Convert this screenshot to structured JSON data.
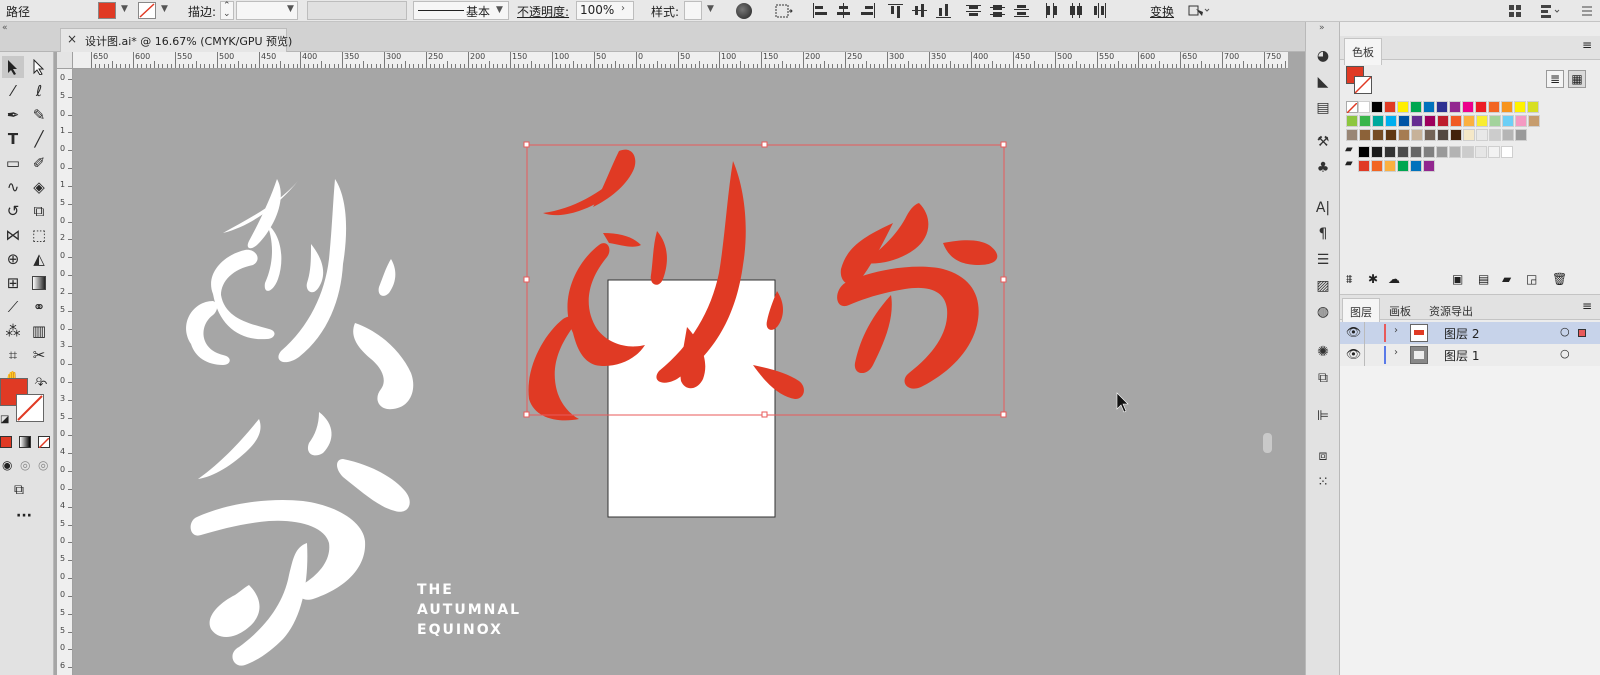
{
  "control_bar": {
    "object_type": "路径",
    "stroke_label": "描边:",
    "stroke_profile": "基本",
    "opacity_label": "不透明度:",
    "opacity_value": "100%",
    "style_label": "样式:",
    "transform_label": "变换",
    "fill_color": "#e03a24"
  },
  "document_tab": {
    "title": "设计图.ai* @ 16.67% (CMYK/GPU 预览)",
    "close": "×"
  },
  "ruler": {
    "h_labels": [
      "650",
      "600",
      "550",
      "500",
      "450",
      "400",
      "350",
      "300",
      "250",
      "200",
      "150",
      "100",
      "50",
      "0",
      "50",
      "100",
      "150",
      "200",
      "250",
      "300",
      "350",
      "400",
      "450",
      "500",
      "550",
      "600",
      "650",
      "700",
      "750"
    ],
    "v_labels": [
      "0",
      "5",
      "0",
      "1",
      "0",
      "0",
      "1",
      "5",
      "0",
      "2",
      "0",
      "0",
      "2",
      "5",
      "0",
      "3",
      "0",
      "0",
      "3",
      "5",
      "0",
      "4",
      "0",
      "0",
      "4",
      "5",
      "0",
      "5",
      "0",
      "0",
      "5",
      "5",
      "0",
      "6"
    ]
  },
  "artwork": {
    "subtitle_lines": [
      "THE",
      "AUTUMNAL",
      "EQUINOX"
    ],
    "red_color": "#e03a24",
    "white_color": "#ffffff"
  },
  "swatches_panel": {
    "title": "色板",
    "colors_row1": [
      "#ffffff",
      "#000000",
      "#e03a24",
      "#ffee00",
      "#00a651",
      "#0072bc",
      "#2e3192",
      "#92278f",
      "#ec008c",
      "#ed1c24",
      "#f26522",
      "#f7941d",
      "#fff200",
      "#d7df23"
    ],
    "colors_row2": [
      "#8dc63f",
      "#39b54a",
      "#00a99d",
      "#00aeef",
      "#0054a6",
      "#662d91",
      "#9e005d",
      "#be1e2d",
      "#f15a24",
      "#fbb040",
      "#f9ed32",
      "#a3d39c",
      "#6dcff6",
      "#f49ac2",
      "#c69c6d"
    ],
    "colors_row3": [
      "#998675",
      "#8c6239",
      "#754c24",
      "#603813",
      "#a67c52",
      "#c7b299",
      "#736357",
      "#534741",
      "#42210b",
      "#f5e8c8",
      "#e8e8e8",
      "#cccccc",
      "#b5b5b5",
      "#9a9a9a"
    ],
    "colors_gray": [
      "#000000",
      "#1a1a1a",
      "#333333",
      "#4d4d4d",
      "#666666",
      "#808080",
      "#999999",
      "#b3b3b3",
      "#cccccc",
      "#e6e6e6",
      "#f2f2f2",
      "#ffffff"
    ],
    "colors_group": [
      "#e03a24",
      "#f26522",
      "#fbb040",
      "#00a651",
      "#0072bc",
      "#92278f"
    ]
  },
  "layers_panel": {
    "tabs": [
      "图层",
      "画板",
      "资源导出"
    ],
    "layers": [
      {
        "name": "图层 2",
        "color": "#e85a5a",
        "selected": true
      },
      {
        "name": "图层 1",
        "color": "#5a7ae8",
        "selected": false
      }
    ]
  }
}
